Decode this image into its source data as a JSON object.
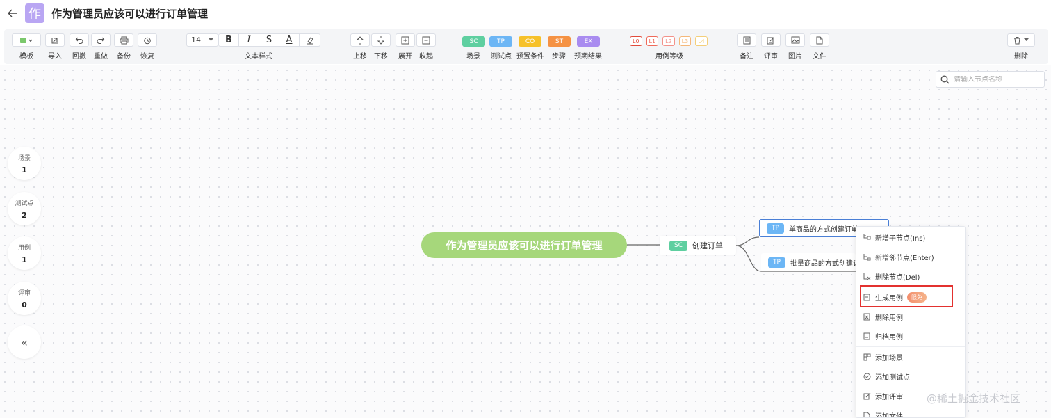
{
  "header": {
    "title": "作为管理员应该可以进行订单管理",
    "avatar_char": "作"
  },
  "toolbar": {
    "template": "模板",
    "import": "导入",
    "undo": "回撤",
    "redo": "重做",
    "backup": "备份",
    "restore": "恢复",
    "font_size": "14",
    "text_style": "文本样式",
    "move_up": "上移",
    "move_down": "下移",
    "expand": "展开",
    "collapse": "收起",
    "tags": [
      {
        "code": "SC",
        "label": "场景",
        "color": "#5ecfa0"
      },
      {
        "code": "TP",
        "label": "测试点",
        "color": "#6cb6f5"
      },
      {
        "code": "CO",
        "label": "预置条件",
        "color": "#f6c12a"
      },
      {
        "code": "ST",
        "label": "步骤",
        "color": "#f59243"
      },
      {
        "code": "EX",
        "label": "预期结果",
        "color": "#a98cf0"
      }
    ],
    "levels": [
      "L0",
      "L1",
      "L2",
      "L3",
      "L4"
    ],
    "levels_label": "用例等级",
    "note": "备注",
    "review": "评审",
    "image": "图片",
    "file": "文件",
    "delete": "删除"
  },
  "search": {
    "placeholder": "请输入节点名称"
  },
  "stats": [
    {
      "label": "场景",
      "value": "1"
    },
    {
      "label": "测试点",
      "value": "2"
    },
    {
      "label": "用例",
      "value": "1"
    },
    {
      "label": "评审",
      "value": "0"
    }
  ],
  "collapse_glyph": "«",
  "mindmap": {
    "root": "作为管理员应该可以进行订单管理",
    "scene": {
      "tag": "SC",
      "text": "创建订单"
    },
    "points": [
      {
        "tag": "TP",
        "text": "单商品的方式创建订单"
      },
      {
        "tag": "TP",
        "text": "批量商品的方式创建订单"
      }
    ]
  },
  "context_menu": {
    "items": [
      "新增子节点(Ins)",
      "新增邻节点(Enter)",
      "删除节点(Del)",
      "生成用例",
      "删除用例",
      "归档用例",
      "添加场景",
      "添加测试点",
      "添加评审",
      "添加文件"
    ],
    "badge": "限免"
  },
  "watermark": "@稀土掘金技术社区"
}
